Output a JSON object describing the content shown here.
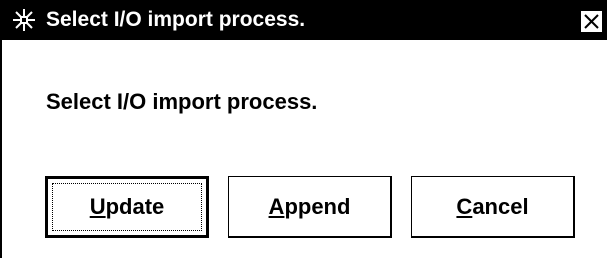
{
  "window": {
    "title": "Select I/O import process.",
    "app_icon": "app-icon",
    "close_icon": "close-x-icon"
  },
  "dialog": {
    "message": "Select I/O import process."
  },
  "buttons": {
    "update": {
      "mnemonic": "U",
      "rest": "pdate"
    },
    "append": {
      "mnemonic": "A",
      "rest": "ppend"
    },
    "cancel": {
      "mnemonic": "C",
      "rest": "ancel"
    }
  },
  "colors": {
    "titlebar_bg": "#000000",
    "titlebar_text": "#ffffff",
    "background": "#ffffff"
  }
}
